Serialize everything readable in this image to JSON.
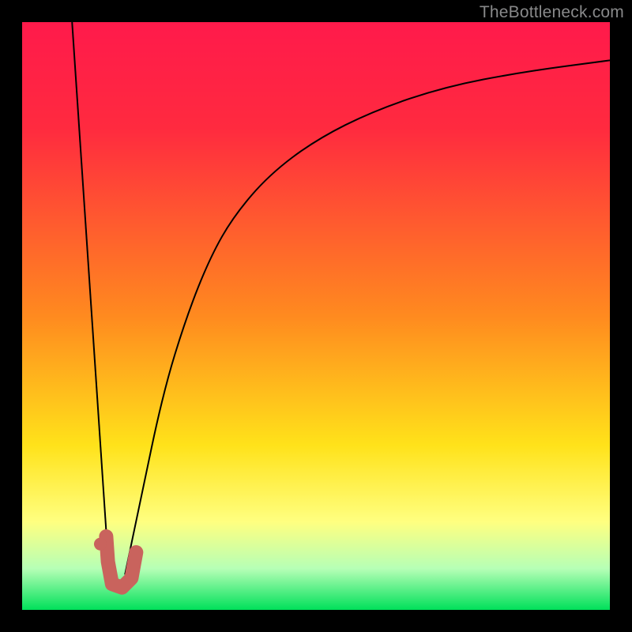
{
  "watermark": "TheBottleneck.com",
  "colors": {
    "top": "#ff1a4b",
    "red": "#ff2a3f",
    "orange": "#ff8a1f",
    "yellow": "#ffe21a",
    "pale_yellow": "#ffff80",
    "pale_green": "#b6ffb6",
    "green": "#00e05a",
    "marker": "#c9635d",
    "curve": "#000000",
    "frame": "#000000"
  },
  "chart_data": {
    "type": "line",
    "title": "",
    "xlabel": "",
    "ylabel": "",
    "xlim": [
      0,
      100
    ],
    "ylim": [
      0,
      100
    ],
    "series": [
      {
        "name": "left-branch",
        "x": [
          8.5,
          14.8
        ],
        "y": [
          100,
          6
        ]
      },
      {
        "name": "right-branch",
        "x": [
          17.5,
          20,
          24,
          28,
          32,
          36,
          42,
          50,
          60,
          72,
          85,
          100
        ],
        "y": [
          6,
          18,
          37,
          50,
          60,
          67,
          74,
          80,
          85,
          89,
          91.5,
          93.5
        ]
      }
    ],
    "marker_path": {
      "name": "j-hook",
      "points": [
        [
          14.3,
          12.5
        ],
        [
          14.6,
          8.2
        ],
        [
          15.3,
          4.4
        ],
        [
          17.0,
          3.8
        ],
        [
          18.6,
          5.4
        ],
        [
          19.4,
          9.8
        ]
      ]
    },
    "marker_dot": {
      "x": 13.3,
      "y": 11.2
    },
    "gradient_stops": [
      {
        "pos": 0,
        "key": "top"
      },
      {
        "pos": 18,
        "key": "red"
      },
      {
        "pos": 50,
        "key": "orange"
      },
      {
        "pos": 72,
        "key": "yellow"
      },
      {
        "pos": 85,
        "key": "pale_yellow"
      },
      {
        "pos": 93,
        "key": "pale_green"
      },
      {
        "pos": 100,
        "key": "green"
      }
    ]
  }
}
